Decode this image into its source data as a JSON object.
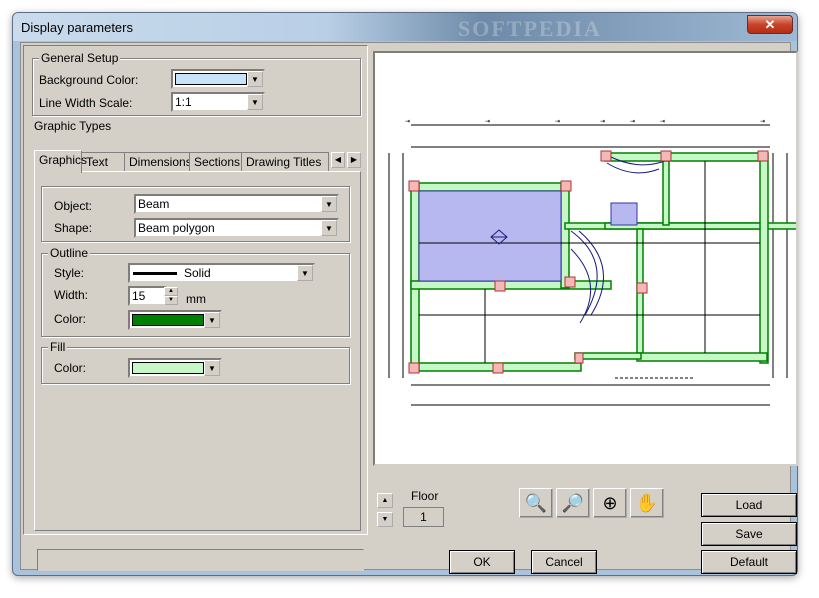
{
  "window": {
    "title": "Display parameters",
    "close_label": "✕",
    "watermark": "SOFTPEDIA"
  },
  "general_setup": {
    "group_label": "General Setup",
    "background_color_label": "Background Color:",
    "background_color_value": "#c8e4fb",
    "line_width_scale_label": "Line Width Scale:",
    "line_width_scale_value": "1:1"
  },
  "graphic_types": {
    "group_label": "Graphic Types",
    "tabs": [
      "Graphics",
      "Text",
      "Dimensions",
      "Sections",
      "Drawing Titles"
    ],
    "active_tab": "Graphics",
    "object_label": "Object:",
    "object_value": "Beam",
    "shape_label": "Shape:",
    "shape_value": "Beam polygon",
    "outline": {
      "group_label": "Outline",
      "style_label": "Style:",
      "style_value": "Solid",
      "width_label": "Width:",
      "width_value": "15",
      "width_unit": "mm",
      "color_label": "Color:",
      "color_value": "#008000"
    },
    "fill": {
      "group_label": "Fill",
      "color_label": "Color:",
      "color_value": "#c6f7c6"
    }
  },
  "preview": {
    "floor_label": "Floor",
    "floor_value": "1",
    "zoom_buttons": [
      "zoom-in-icon",
      "zoom-out-icon",
      "zoom-extents-icon",
      "pan-hand-icon"
    ]
  },
  "buttons": {
    "load": "Load",
    "save": "Save",
    "default": "Default",
    "ok": "OK",
    "cancel": "Cancel"
  },
  "colors": {
    "dialog_bg": "#d4d0c8",
    "beam_fill": "#c6f7c6",
    "beam_outline": "#008000",
    "slab_fill": "#b8b8f0",
    "column_fill": "#f4b8b8"
  }
}
